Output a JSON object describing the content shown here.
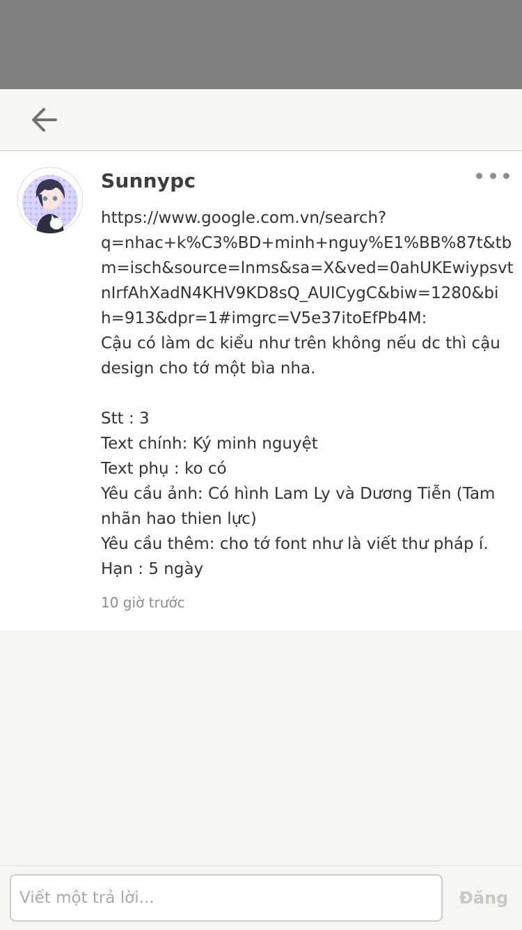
{
  "icons": {
    "back": "arrow-left-icon",
    "more": "more-horizontal-icon"
  },
  "colors": {
    "background": "#f7f6f2",
    "card": "#ffffff",
    "text": "#333333",
    "muted": "#8d8d8d",
    "disabled": "#c8c8c8"
  },
  "post": {
    "author": "Sunnypc",
    "body_lines": [
      "https://www.google.com.vn/search?",
      "q=nhac+k%C3%BD+minh+nguy%E1%BB%87t&tb",
      "m=isch&source=lnms&sa=X&ved=0ahUKEwiypsvt",
      "nIrfAhXadN4KHV9KD8sQ_AUICygC&biw=1280&bi",
      "h=913&dpr=1#imgrc=V5e37itoEfPb4M:",
      "Cậu có làm dc kiểu như trên không nếu dc thì cậu",
      "design cho tớ một bìa nha.",
      "",
      "Stt : 3",
      "Text chính: Ký minh nguyệt",
      "Text phụ : ko có",
      "Yêu cầu ảnh: Có hình Lam Ly và Dương Tiễn (Tam",
      "nhãn hao thien lực)",
      "Yêu cầu thêm: cho tớ font như là viết thư pháp í.",
      "Hạn : 5 ngày"
    ],
    "timestamp": "10 giờ trước"
  },
  "reply": {
    "placeholder": "Viết một trả lời...",
    "value": "",
    "post_label": "Đăng"
  }
}
